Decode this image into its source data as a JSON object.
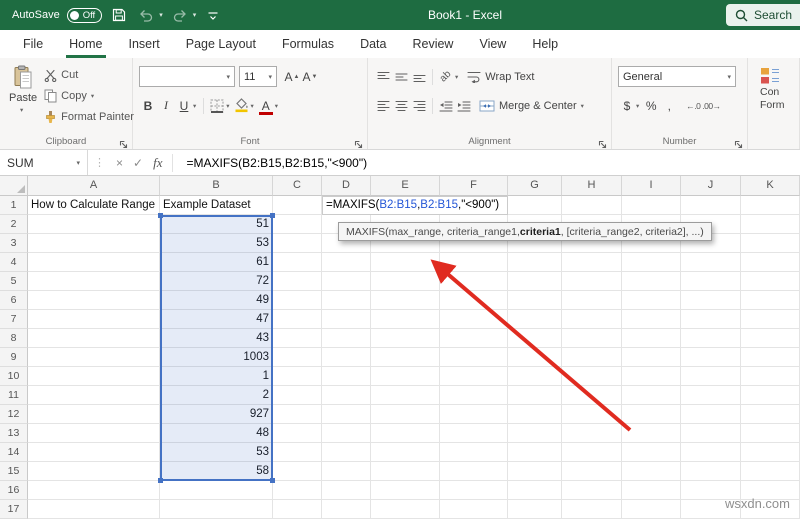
{
  "colors": {
    "title_green": "#1E6C41",
    "tab_accent": "#217346",
    "range_border": "#4472C4",
    "range_fill": "rgba(68,114,196,0.14)",
    "ref_blue": "#2456D6",
    "arrow_red": "#E02B20"
  },
  "title_bar": {
    "autosave_label": "AutoSave",
    "autosave_state": "Off",
    "title": "Book1  -  Excel",
    "search_label": "Search"
  },
  "ribbon": {
    "tabs": [
      {
        "label": "File",
        "active": false
      },
      {
        "label": "Home",
        "active": true
      },
      {
        "label": "Insert",
        "active": false
      },
      {
        "label": "Page Layout",
        "active": false
      },
      {
        "label": "Formulas",
        "active": false
      },
      {
        "label": "Data",
        "active": false
      },
      {
        "label": "Review",
        "active": false
      },
      {
        "label": "View",
        "active": false
      },
      {
        "label": "Help",
        "active": false
      }
    ],
    "clipboard": {
      "label": "Clipboard",
      "paste": "Paste",
      "cut": "Cut",
      "copy": "Copy",
      "format_painter": "Format Painter"
    },
    "font": {
      "label": "Font",
      "size": "11"
    },
    "alignment": {
      "label": "Alignment",
      "wrap_text": "Wrap Text",
      "merge_center": "Merge & Center"
    },
    "number": {
      "label": "Number",
      "format": "General"
    },
    "clipped_button": {
      "line1": "Con",
      "line2": "Form"
    }
  },
  "formula_bar": {
    "name_box": "SUM",
    "formula": "=MAXIFS(B2:B15,B2:B15,\"<900\")"
  },
  "grid": {
    "columns": [
      "A",
      "B",
      "C",
      "D",
      "E",
      "F",
      "G",
      "H",
      "I",
      "J",
      "K"
    ],
    "row_count": 17,
    "a1": "How to Calculate Range",
    "b1": "Example Dataset",
    "b_values": [
      51,
      53,
      61,
      72,
      49,
      47,
      43,
      1003,
      1,
      2,
      927,
      48,
      53,
      58
    ],
    "active_cell_formula_parts": [
      {
        "text": "=MAXIFS(",
        "color": "#000000"
      },
      {
        "text": "B2:B15",
        "color": "#2456D6"
      },
      {
        "text": ",",
        "color": "#000000"
      },
      {
        "text": "B2:B15",
        "color": "#2456D6"
      },
      {
        "text": ",\"<900\")",
        "color": "#000000"
      }
    ]
  },
  "tooltip": {
    "pre": "MAXIFS(max_range, criteria_range1, ",
    "bold": "criteria1",
    "post": ", [criteria_range2, criteria2], ...)"
  },
  "watermark": "wsxdn.com"
}
